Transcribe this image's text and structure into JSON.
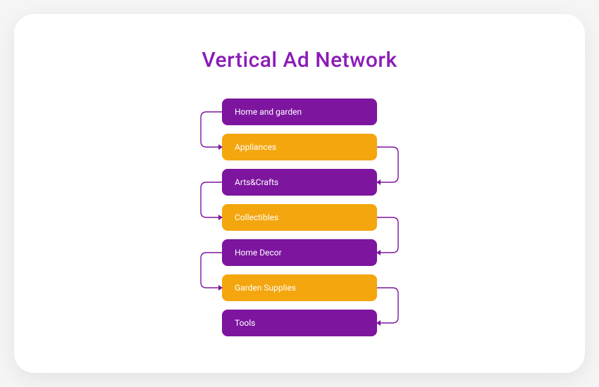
{
  "title": "Vertical Ad Network",
  "colors": {
    "purple": "#7d159f",
    "orange": "#f4a60e",
    "title": "#8a1bb8"
  },
  "nodes": [
    {
      "label": "Home and garden",
      "color": "purple"
    },
    {
      "label": "Appliances",
      "color": "orange"
    },
    {
      "label": "Arts&Crafts",
      "color": "purple"
    },
    {
      "label": "Collectibles",
      "color": "orange"
    },
    {
      "label": "Home Decor",
      "color": "purple"
    },
    {
      "label": "Garden Supplies",
      "color": "orange"
    },
    {
      "label": "Tools",
      "color": "purple"
    }
  ],
  "connectors": [
    {
      "from": 0,
      "to": 1,
      "side": "left"
    },
    {
      "from": 1,
      "to": 2,
      "side": "right"
    },
    {
      "from": 2,
      "to": 3,
      "side": "left"
    },
    {
      "from": 3,
      "to": 4,
      "side": "right"
    },
    {
      "from": 4,
      "to": 5,
      "side": "left"
    },
    {
      "from": 5,
      "to": 6,
      "side": "right"
    }
  ]
}
